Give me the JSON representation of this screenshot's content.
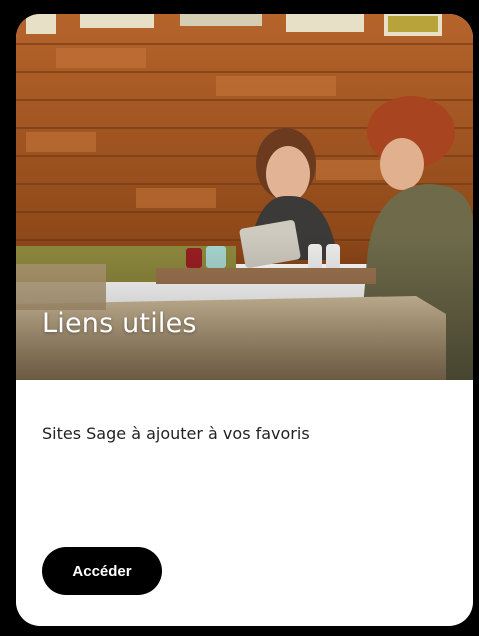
{
  "card": {
    "title": "Liens utiles",
    "description": "Sites Sage à ajouter à vos favoris",
    "button_label": "Accéder"
  },
  "colors": {
    "button_bg": "#000000",
    "button_text": "#ffffff",
    "title_text": "#ffffff",
    "card_bg": "#ffffff",
    "frame": "#000000"
  },
  "icons": {
    "hero": "cafe-meeting-photo"
  }
}
